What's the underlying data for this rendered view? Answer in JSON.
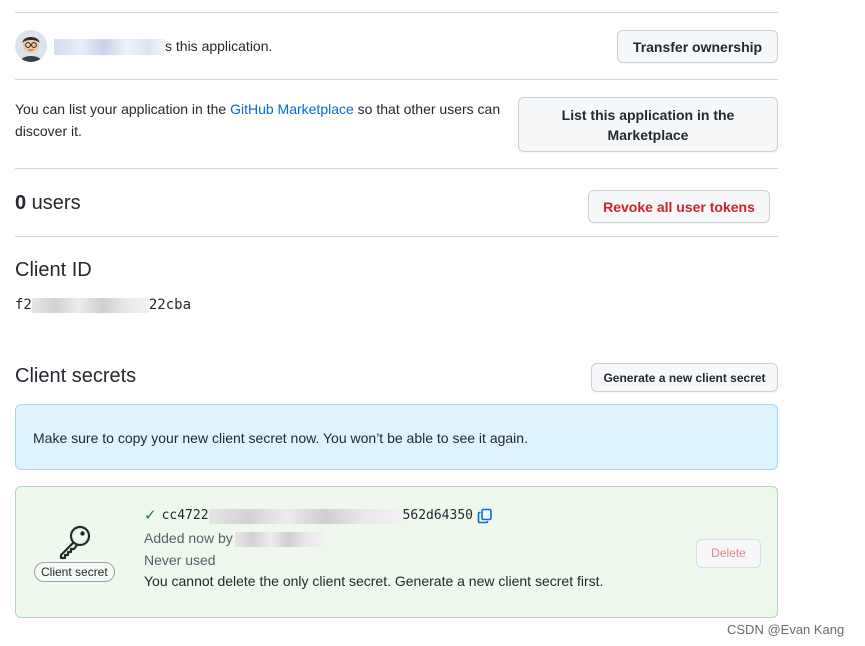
{
  "owner": {
    "suffix_text": "s this application.",
    "transfer_label": "Transfer ownership"
  },
  "marketplace": {
    "text_before": "You can list your application in the ",
    "link_text": "GitHub Marketplace",
    "text_after": " so that other users can discover it.",
    "button_label": "List this application in the Marketplace"
  },
  "users": {
    "count": "0",
    "label": " users",
    "revoke_label": "Revoke all user tokens"
  },
  "client_id": {
    "heading": "Client ID",
    "value_start": "f2",
    "value_end": "22cba"
  },
  "client_secrets": {
    "heading": "Client secrets",
    "generate_label": "Generate a new client secret",
    "notice": "Make sure to copy your new client secret now. You won’t be able to see it again.",
    "secret": {
      "value_start": "cc4722",
      "value_end": "562d64350",
      "added_text": "Added now by",
      "usage_text": "Never used",
      "warning_text": "You cannot delete the only client secret. Generate a new client secret first.",
      "badge_label": "Client secret",
      "delete_label": "Delete"
    }
  },
  "watermark": "CSDN @Evan Kang",
  "colors": {
    "link": "#0969da",
    "danger": "#cf222e",
    "notice_bg": "#ddf4ff",
    "success_bg": "#eef8ec",
    "check": "#1a7f37"
  }
}
